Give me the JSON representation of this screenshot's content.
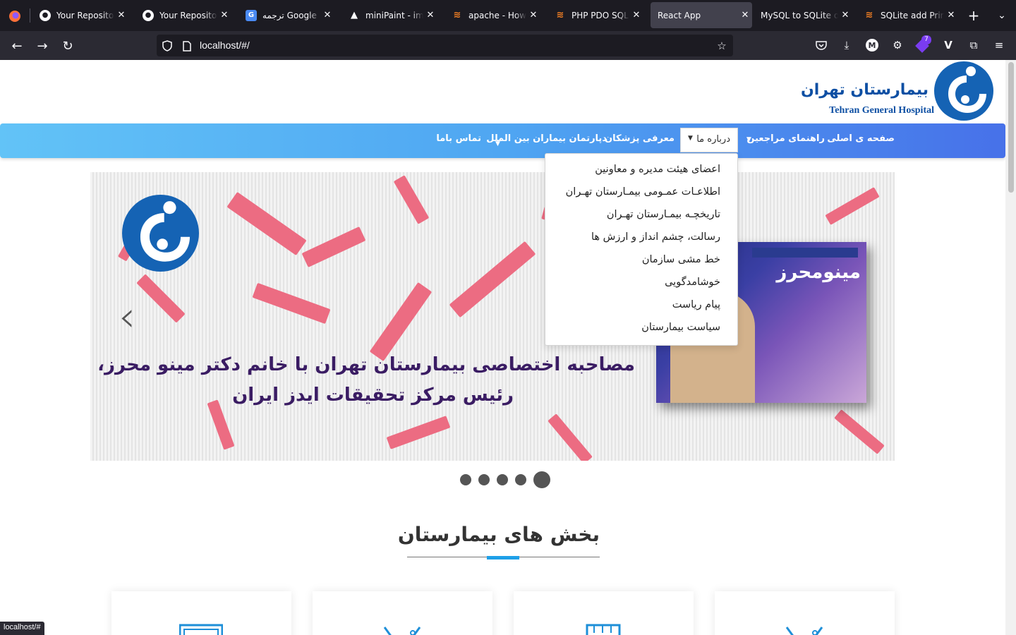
{
  "browser": {
    "tabs": [
      {
        "title": "Your Repositories",
        "favicon": "github-icon"
      },
      {
        "title": "Your Repositories",
        "favicon": "github-icon"
      },
      {
        "title": "ترجمه Google",
        "favicon": "google-translate-icon"
      },
      {
        "title": "miniPaint - image editor",
        "favicon": "minipaint-icon"
      },
      {
        "title": "apache - How to",
        "favicon": "stackoverflow-icon"
      },
      {
        "title": "PHP PDO SQLite",
        "favicon": "stackoverflow-icon"
      },
      {
        "title": "React App",
        "favicon": "react-icon",
        "active": true
      },
      {
        "title": "MySQL to SQLite online",
        "favicon": "none"
      },
      {
        "title": "SQLite add Primary Key",
        "favicon": "stackoverflow-icon"
      }
    ],
    "url": "localhost/#/",
    "status_text": "localhost/#",
    "notification_badge": "7",
    "extension_m_label": "M"
  },
  "header": {
    "logo_title_fa": "بیمارستان تهران",
    "logo_title_en": "Tehran General Hospital"
  },
  "nav": {
    "home": "صفحه ی اصلی",
    "patients_guide": "راهنمای مراجعین",
    "about": "درباره ما",
    "doctors": "معرفی پزشکان",
    "intl_patients": "دپارتمان بیماران بین الملل",
    "contact": "تماس باما"
  },
  "about_dropdown": [
    "اعضای هیئت مدیره و معاونین",
    "اطلاعـات عمـومی بیمـارستان تهـران",
    "تاریخچـه بیمـارستان تهـران",
    "رسالت، چشم انداز و ارزش ها",
    "خط مشی سازمان",
    "خوشامدگویی",
    "پیام ریاست",
    "سیاست بیمارستان"
  ],
  "slider": {
    "caption_line1": "مصاحبه اختصاصی بیمارستان تهران با خانم دکتر مینو محرز،",
    "caption_line2": "رئیس مرکز تحقیقات ایدز ایران",
    "photo_sign": "مینومحرز",
    "dots_count": 5,
    "active_dot": 5
  },
  "section": {
    "title": "بخش های بیمارستان"
  },
  "colors": {
    "brand_blue": "#1563b4",
    "menu_gradient_start": "#62c3f7",
    "menu_gradient_end": "#4771e9",
    "accent": "#1ea0e8",
    "caption": "#3a1c63"
  }
}
